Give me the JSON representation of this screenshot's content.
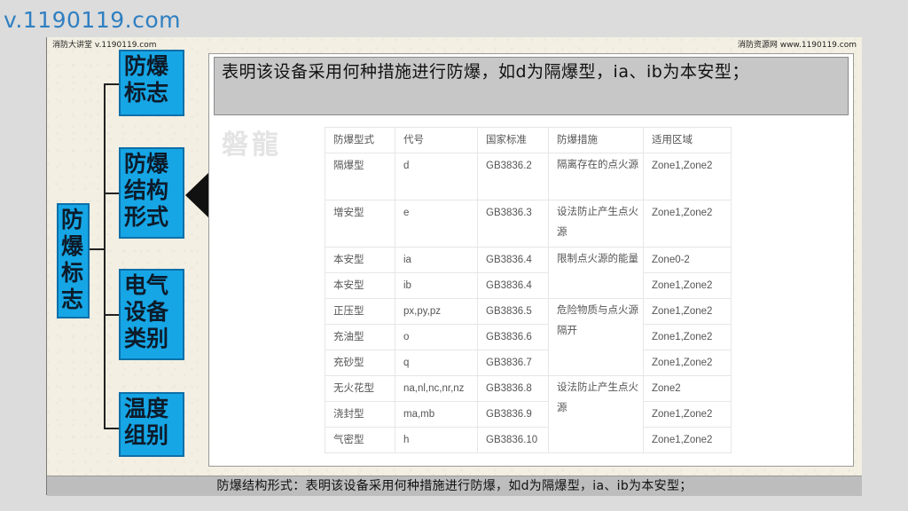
{
  "watermark": "v.1190119.com",
  "header": {
    "left": "消防大讲堂 v.1190119.com",
    "right": "消防资源网 www.1190119.com"
  },
  "tree": {
    "root": "防\n爆\n标\n志",
    "nodes": [
      "防爆\n标志",
      "防爆\n结构\n形式",
      "电气\n设备\n类别",
      "温度\n组别"
    ]
  },
  "callout": "表明该设备采用何种措施进行防爆，如d为隔爆型，ia、ib为本安型；",
  "faint_logo": "磐龍",
  "table": {
    "headers": [
      "防爆型式",
      "代号",
      "国家标准",
      "防爆措施",
      "适用区域"
    ],
    "rows": [
      {
        "type": "隔爆型",
        "code": "d",
        "standard": "GB3836.2",
        "zone": "Zone1,Zone2"
      },
      {
        "type": "增安型",
        "code": "e",
        "standard": "GB3836.3",
        "zone": "Zone1,Zone2"
      },
      {
        "type": "本安型",
        "code": "ia",
        "standard": "GB3836.4",
        "zone": "Zone0-2"
      },
      {
        "type": "本安型",
        "code": "ib",
        "standard": "GB3836.4",
        "zone": "Zone1,Zone2"
      },
      {
        "type": "正压型",
        "code": "px,py,pz",
        "standard": "GB3836.5",
        "zone": "Zone1,Zone2"
      },
      {
        "type": "充油型",
        "code": "o",
        "standard": "GB3836.6",
        "zone": "Zone1,Zone2"
      },
      {
        "type": "充砂型",
        "code": "q",
        "standard": "GB3836.7",
        "zone": "Zone1,Zone2"
      },
      {
        "type": "无火花型",
        "code": "na,nl,nc,nr,nz",
        "standard": "GB3836.8",
        "zone": "Zone2"
      },
      {
        "type": "浇封型",
        "code": "ma,mb",
        "standard": "GB3836.9",
        "zone": "Zone1,Zone2"
      },
      {
        "type": "气密型",
        "code": "h",
        "standard": "GB3836.10",
        "zone": "Zone1,Zone2"
      }
    ],
    "measures": [
      "隔离存在的点火源",
      "设法防止产生点火源",
      "限制点火源的能量",
      "危险物质与点火源隔开",
      "设法防止产生点火源"
    ]
  },
  "footer": "防爆结构形式：表明该设备采用何种措施进行防爆，如d为隔爆型，ia、ib为本安型；",
  "colors": {
    "box_fill": "#16a6e6",
    "box_border": "#0d6fa8",
    "callout_bg": "#c7c7c7",
    "watermark": "#2f7fc1"
  }
}
